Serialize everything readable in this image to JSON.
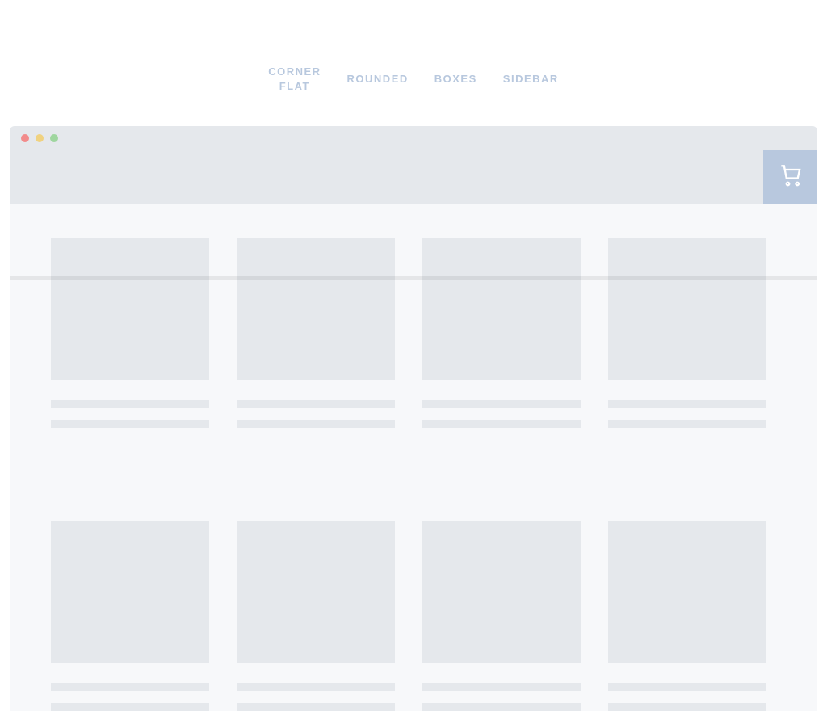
{
  "tabs": [
    {
      "label": "CORNER\nFLAT"
    },
    {
      "label": "ROUNDED"
    },
    {
      "label": "BOXES"
    },
    {
      "label": "SIDEBAR"
    }
  ],
  "colors": {
    "accent": "#b8c8de",
    "placeholder": "#e5e8ec",
    "page_bg": "#f7f8fa",
    "traffic_red": "#f28b8b",
    "traffic_yellow": "#f0d280",
    "traffic_green": "#9fd69f"
  },
  "icons": {
    "cart": "cart-icon"
  },
  "products": {
    "row1": [
      {
        "title": "",
        "subtitle": ""
      },
      {
        "title": "",
        "subtitle": ""
      },
      {
        "title": "",
        "subtitle": ""
      },
      {
        "title": "",
        "subtitle": ""
      }
    ],
    "row2": [
      {
        "title": "",
        "subtitle": ""
      },
      {
        "title": "",
        "subtitle": ""
      },
      {
        "title": "",
        "subtitle": ""
      },
      {
        "title": "",
        "subtitle": ""
      }
    ]
  }
}
